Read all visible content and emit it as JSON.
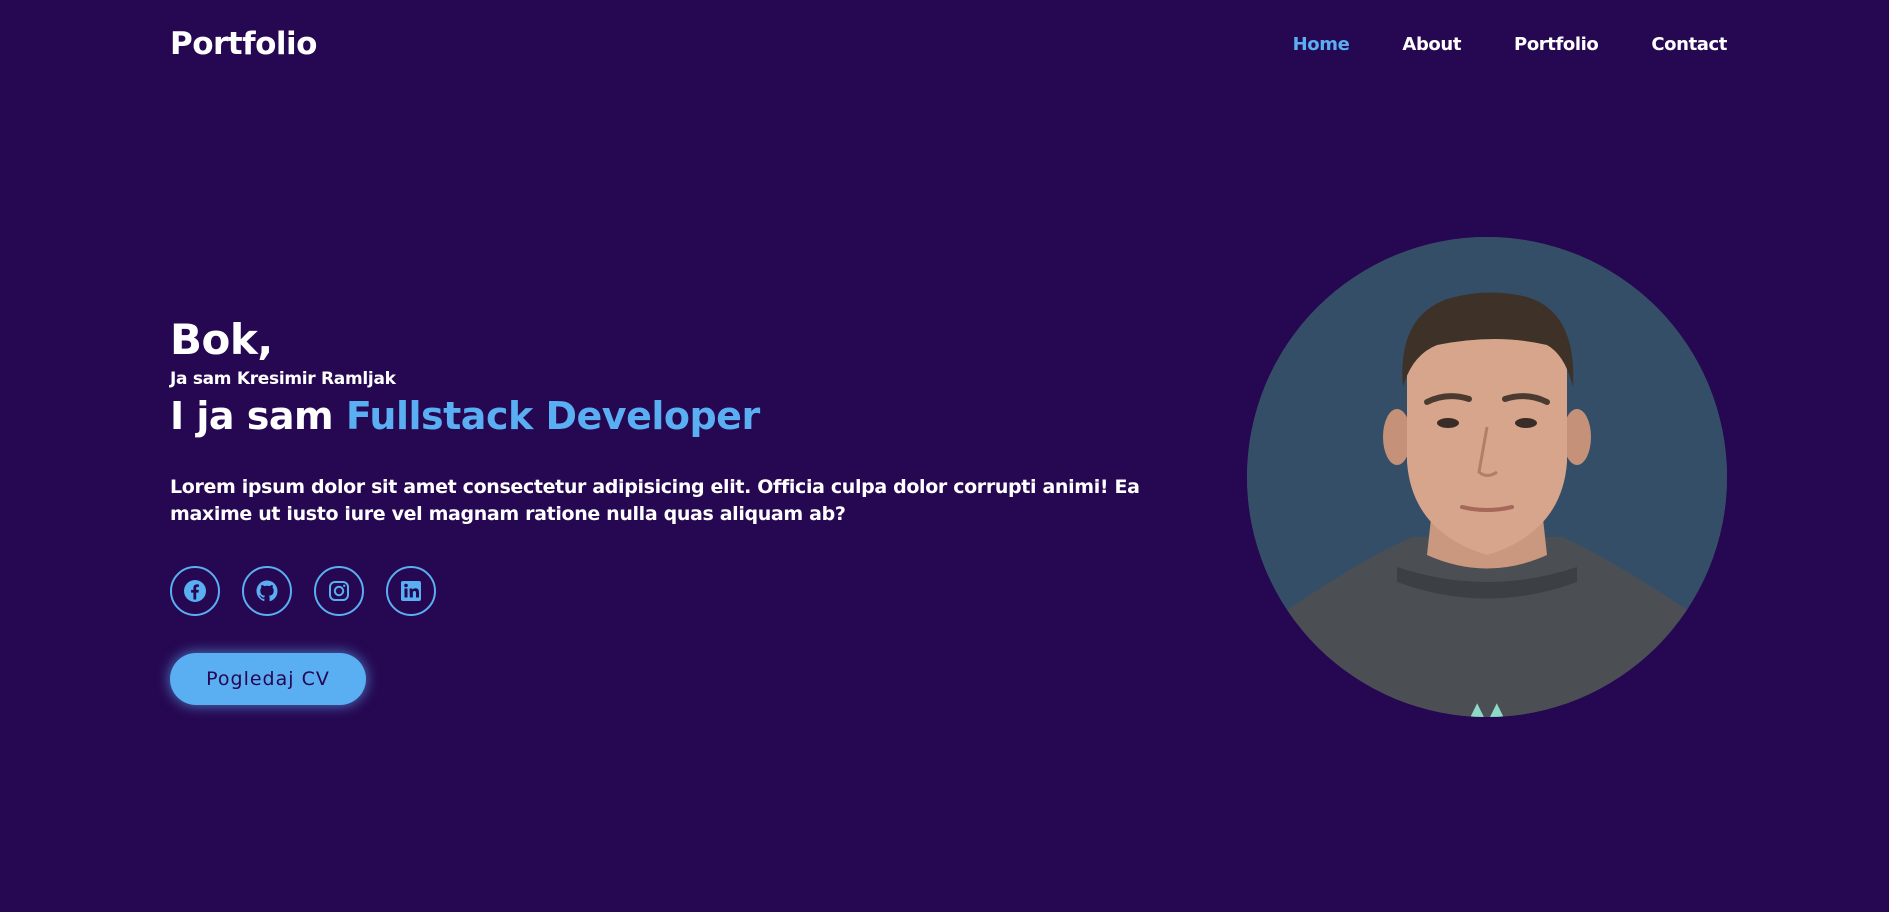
{
  "header": {
    "logo": "Portfolio",
    "nav": [
      {
        "label": "Home",
        "active": true
      },
      {
        "label": "About",
        "active": false
      },
      {
        "label": "Portfolio",
        "active": false
      },
      {
        "label": "Contact",
        "active": false
      }
    ]
  },
  "hero": {
    "greeting": "Bok,",
    "name_line": "Ja sam Kresimir Ramljak",
    "role_prefix": "I ja sam",
    "role_highlight": "Fullstack Developer",
    "description": "Lorem ipsum dolor sit amet consectetur adipisicing elit. Officia culpa dolor corrupti animi! Ea maxime ut iusto iure vel magnam ratione nulla quas aliquam ab?",
    "socials": [
      {
        "icon": "facebook-icon"
      },
      {
        "icon": "github-icon"
      },
      {
        "icon": "instagram-icon"
      },
      {
        "icon": "linkedin-icon"
      }
    ],
    "cv_button": "Pogledaj CV"
  },
  "colors": {
    "background": "#260751",
    "accent": "#5aaef2",
    "text": "#ffffff",
    "portrait_bg": "#354e68"
  }
}
